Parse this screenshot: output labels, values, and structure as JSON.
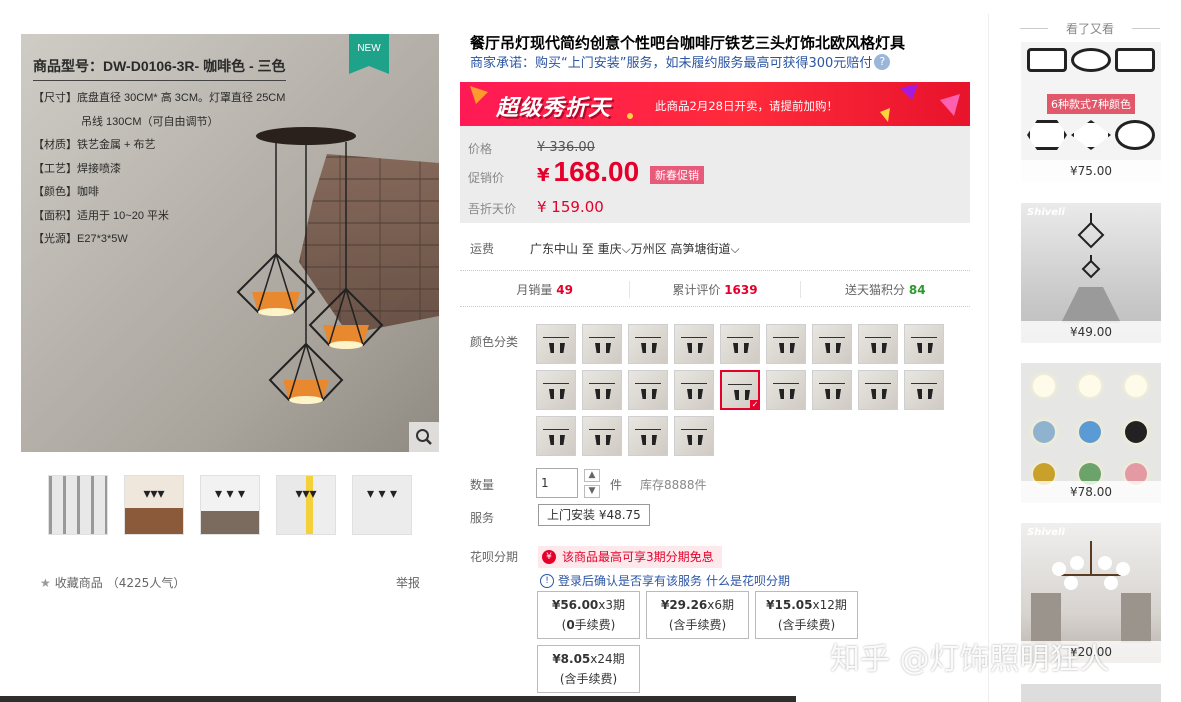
{
  "product": {
    "title": "餐厅吊灯现代简约创意个性吧台咖啡厅铁艺三头灯饰北欧风格灯具",
    "promise": "商家承诺：购买“上门安装”服务，如未履约服务最高可获得300元赔付",
    "help_icon": "?"
  },
  "gallery": {
    "badge": "NEW",
    "model": "商品型号：DW-D0106-3R- 咖啡色 - 三色",
    "specs": [
      "【尺寸】底盘直径 30CM* 高 3CM。灯罩直径 25CM",
      "吊线 130CM（可自由调节）",
      "【材质】铁艺金属 + 布艺",
      "【工艺】焊接喷漆",
      "【颜色】咖啡",
      "【面积】适用于 10~20 平米",
      "【光源】E27*3*5W"
    ],
    "favorite_label": "收藏商品",
    "popularity": "（4225人气）",
    "report_label": "举报"
  },
  "banner": {
    "big_text": "超级秀折天",
    "note": "此商品2月28日开卖，请提前加购！"
  },
  "price": {
    "orig_label": "价格",
    "orig_value": "¥ 336.00",
    "promo_label": "促销价",
    "promo_currency": "¥",
    "promo_value": "168.00",
    "promo_tag": "新春促销",
    "zhe_label": "吾折天价",
    "zhe_value": "¥ 159.00"
  },
  "shipping": {
    "label": "运费",
    "value": "广东中山  至  重庆⌵万州区  高笋塘街道⌵"
  },
  "stats": {
    "monthly_label": "月销量",
    "monthly_value": "49",
    "reviews_label": "累计评价",
    "reviews_value": "1639",
    "points_label": "送天猫积分",
    "points_value": "84"
  },
  "options": {
    "color_label": "颜色分类",
    "swatch_count": 22,
    "selected_index": 13,
    "qty_label": "数量",
    "qty_value": "1",
    "qty_unit": "件",
    "stock": "库存8888件",
    "service_label": "服务",
    "service_button": "上门安装 ¥48.75"
  },
  "huabei": {
    "label": "花呗分期",
    "tag": "该商品最高可享3期分期免息",
    "info": "登录后确认是否享有该服务",
    "link": "什么是花呗分期",
    "plans": [
      {
        "amount": "¥56.00",
        "periods": "x3期",
        "fee_bold": "0",
        "fee": "手续费)",
        "prefix": "("
      },
      {
        "amount": "¥29.26",
        "periods": "x6期",
        "fee_bold": "",
        "fee": "(含手续费)",
        "prefix": ""
      },
      {
        "amount": "¥15.05",
        "periods": "x12期",
        "fee_bold": "",
        "fee": "(含手续费)",
        "prefix": ""
      },
      {
        "amount": "¥8.05",
        "periods": "x24期",
        "fee_bold": "",
        "fee": "(含手续费)",
        "prefix": ""
      }
    ]
  },
  "sidebar": {
    "heading": "看了又看",
    "items": [
      {
        "price": "¥75.00",
        "label": "6种款式7种颜色"
      },
      {
        "price": "¥49.00",
        "brand": "Shiveli"
      },
      {
        "price": "¥78.00"
      },
      {
        "price": "¥20.00",
        "brand": "Shiveli"
      }
    ]
  },
  "watermark": "知乎 @灯饰照明狂人",
  "colors": {
    "accent_red": "#e4002b",
    "link_blue": "#2b55a3",
    "banner_pink": "#ff1a55",
    "badge_green": "#1fa28a"
  }
}
